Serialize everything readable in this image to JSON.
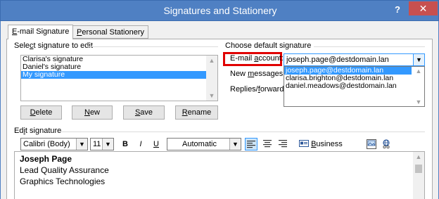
{
  "window": {
    "title": "Signatures and Stationery",
    "help_label": "?",
    "close_label": "✕"
  },
  "tabs": [
    {
      "label": "E-mail Signature",
      "ul": "E",
      "rest": "-mail Signature"
    },
    {
      "label": "Personal Stationery",
      "ul": "P",
      "rest": "ersonal Stationery"
    }
  ],
  "select_group": {
    "label_pre": "Sele",
    "label_ul": "c",
    "label_post": "t signature to edit",
    "items": [
      "Clarisa's signature",
      "Daniel's signature",
      "My signature"
    ],
    "selected_index": 2
  },
  "actions": {
    "delete": {
      "ul": "D",
      "rest": "elete"
    },
    "new": {
      "ul": "N",
      "rest": "ew"
    },
    "save": {
      "ul": "S",
      "rest": "ave"
    },
    "rename": {
      "ul": "R",
      "rest": "ename"
    }
  },
  "default_group": {
    "label": "Choose default signature",
    "email_account_label": "E-mail account:",
    "email_account_pre": "E-mail ",
    "email_account_ul": "a",
    "email_account_post": "ccount:",
    "email_account_value": "joseph.page@destdomain.lan",
    "new_messages_pre": "New ",
    "new_messages_ul": "m",
    "new_messages_post": "essages:",
    "replies_pre": "Replies/",
    "replies_ul": "f",
    "replies_post": "orwards:",
    "dropdown_options": [
      "joseph.page@destdomain.lan",
      "clarisa.brighton@destdomain.lan",
      "daniel.meadows@destdomain.lan"
    ],
    "dropdown_selected_index": 0
  },
  "edit_group": {
    "label_pre": "Ed",
    "label_ul": "i",
    "label_post": "t signature"
  },
  "toolbar": {
    "font": "Calibri (Body)",
    "size": "11",
    "bold": "B",
    "italic": "I",
    "underline": "U",
    "color": "Automatic",
    "business_card_ul": "B",
    "business_card_rest": "usiness Card"
  },
  "editor": {
    "lines": [
      "Joseph Page",
      "Lead Quality Assurance",
      "Graphics Technologies"
    ]
  },
  "colors": {
    "titlebar": "#4f80c3",
    "close": "#c75050",
    "selection": "#3399ff",
    "highlight": "#e00000"
  }
}
